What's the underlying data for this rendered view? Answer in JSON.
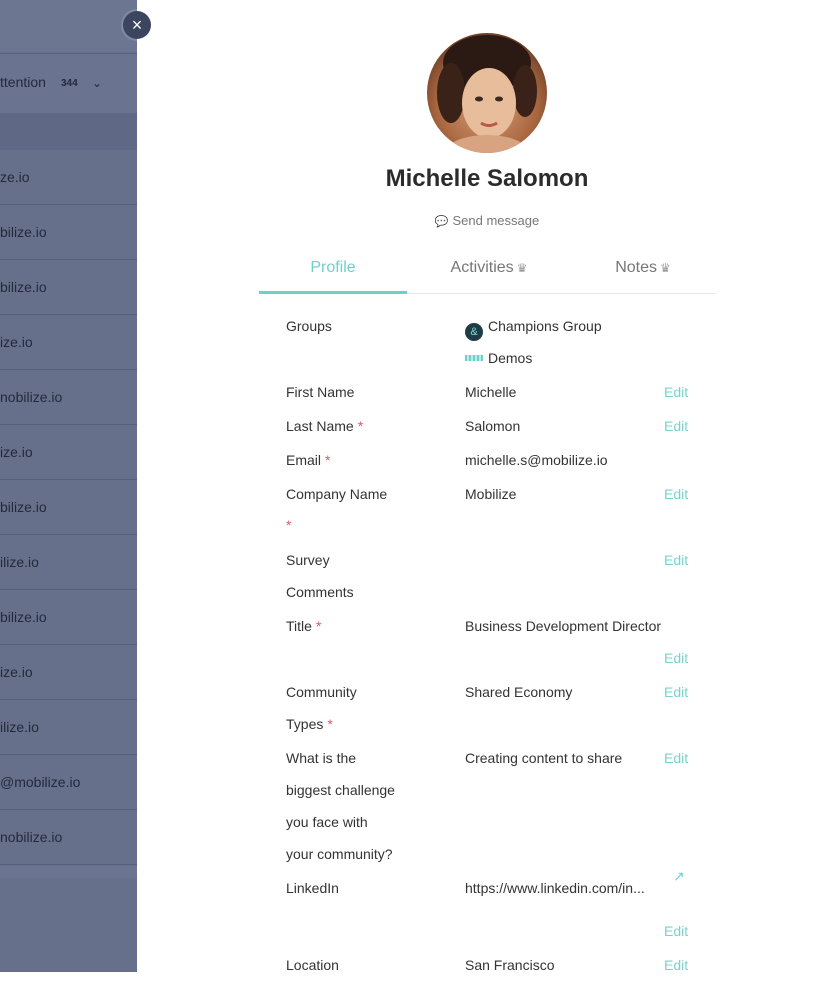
{
  "background_list": {
    "attention": {
      "text": "ttention",
      "count": "344",
      "chevron": "chevron-down-icon"
    },
    "rows": [
      "ze.io",
      "bilize.io",
      "bilize.io",
      "ize.io",
      "nobilize.io",
      "ize.io",
      "bilize.io",
      "ilize.io",
      "bilize.io",
      "ize.io",
      "ilize.io",
      "@mobilize.io",
      "nobilize.io"
    ]
  },
  "close_button": {
    "icon": "close-icon",
    "glyph": "×"
  },
  "profile": {
    "name": "Michelle Salomon",
    "send_message": "Send message"
  },
  "tabs": [
    {
      "label": "Profile",
      "active": true
    },
    {
      "label": "Activities",
      "active": false,
      "premium": true
    },
    {
      "label": "Notes",
      "active": false,
      "premium": true
    }
  ],
  "fields": {
    "groups_label": "Groups",
    "groups": [
      "Champions Group",
      "Demos"
    ],
    "first_name_label": "First Name",
    "first_name": "Michelle",
    "last_name_label": "Last Name",
    "last_name": "Salomon",
    "email_label": "Email",
    "email": "michelle.s@mobilize.io",
    "company_label": "Company Name",
    "company": "Mobilize",
    "survey_label_1": "Survey",
    "survey_label_2": "Comments",
    "title_label": "Title",
    "title": "Business Development Director",
    "community_label_1": "Community",
    "community_label_2": "Types",
    "community": "Shared Economy",
    "challenge_label": [
      "What is the",
      "biggest challenge",
      "you face with",
      "your community?"
    ],
    "challenge": "Creating content to share",
    "linkedin_label": "LinkedIn",
    "linkedin": "https://www.linkedin.com/in...",
    "location_label": "Location",
    "location": "San Francisco",
    "edit": "Edit",
    "required_mark": "*"
  },
  "colors": {
    "accent": "#6fcfca",
    "required": "#e5566b",
    "overlay": "#67708a",
    "close_bg": "#3b4560"
  }
}
